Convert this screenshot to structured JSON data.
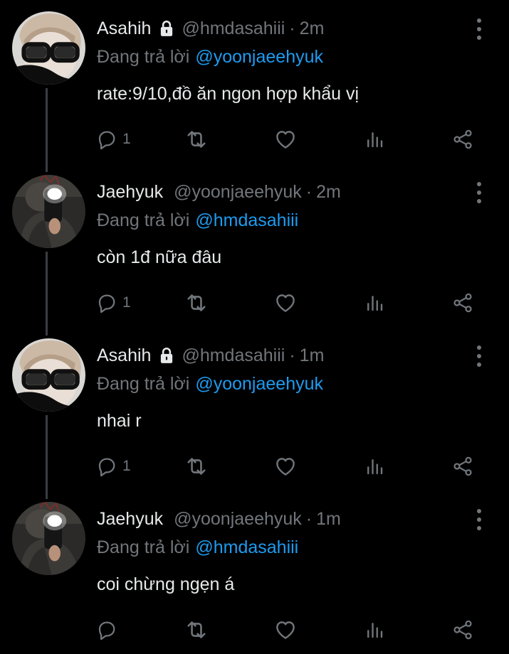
{
  "reply_prefix": "Đang trả lời",
  "separator": "·",
  "colors": {
    "background": "#000000",
    "text": "#e7e9ea",
    "muted": "#71767b",
    "link": "#1d9bf0",
    "thread_line": "#3a3d41"
  },
  "icons": {
    "reply": "speech-bubble-icon",
    "retweet": "retweet-icon",
    "like": "heart-icon",
    "views": "bar-chart-icon",
    "share": "share-icon",
    "more": "vertical-dots-icon",
    "protected": "lock-icon"
  },
  "tweets": [
    {
      "name": "Asahih",
      "protected": true,
      "handle": "@hmdasahiii",
      "time": "2m",
      "reply_to": "@yoonjaeehyuk",
      "text": "rate:9/10,đồ ăn ngon hợp khẩu vị",
      "reply_count": "1"
    },
    {
      "name": "Jaehyuk",
      "protected": false,
      "handle": "@yoonjaeehyuk",
      "time": "2m",
      "reply_to": "@hmdasahiii",
      "text": "còn 1đ nữa đâu",
      "reply_count": "1"
    },
    {
      "name": "Asahih",
      "protected": true,
      "handle": "@hmdasahiii",
      "time": "1m",
      "reply_to": "@yoonjaeehyuk",
      "text": "nhai r",
      "reply_count": "1"
    },
    {
      "name": "Jaehyuk",
      "protected": false,
      "handle": "@yoonjaeehyuk",
      "time": "1m",
      "reply_to": "@hmdasahiii",
      "text": "coi chừng ngẹn á",
      "reply_count": ""
    }
  ]
}
